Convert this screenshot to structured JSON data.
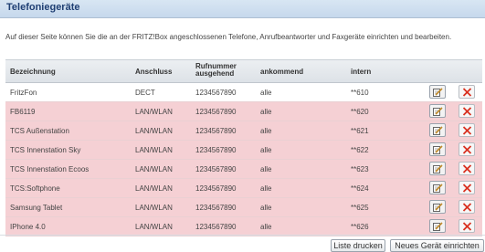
{
  "header": {
    "title": "Telefoniegeräte"
  },
  "intro": "Auf dieser Seite können Sie die an der FRITZ!Box angeschlossenen Telefone, Anrufbeantworter und Faxgeräte einrichten und bearbeiten.",
  "table": {
    "headers": {
      "name": "Bezeichnung",
      "anschluss": "Anschluss",
      "rufnummer_line1": "Rufnummer",
      "rufnummer_line2": "ausgehend",
      "ankommend": "ankommend",
      "intern": "intern"
    },
    "rows": [
      {
        "name": "FritzFon",
        "anschluss": "DECT",
        "rufnummer": "1234567890",
        "ankommend": "alle",
        "intern": "**610"
      },
      {
        "name": "FB6119",
        "anschluss": "LAN/WLAN",
        "rufnummer": "1234567890",
        "ankommend": "alle",
        "intern": "**620"
      },
      {
        "name": "TCS Außenstation",
        "anschluss": "LAN/WLAN",
        "rufnummer": "1234567890",
        "ankommend": "alle",
        "intern": "**621"
      },
      {
        "name": "TCS Innenstation Sky",
        "anschluss": "LAN/WLAN",
        "rufnummer": "1234567890",
        "ankommend": "alle",
        "intern": "**622"
      },
      {
        "name": "TCS Innenstation Ecoos",
        "anschluss": "LAN/WLAN",
        "rufnummer": "1234567890",
        "ankommend": "alle",
        "intern": "**623"
      },
      {
        "name": "TCS:Softphone",
        "anschluss": "LAN/WLAN",
        "rufnummer": "1234567890",
        "ankommend": "alle",
        "intern": "**624"
      },
      {
        "name": "Samsung Tablet",
        "anschluss": "LAN/WLAN",
        "rufnummer": "1234567890",
        "ankommend": "alle",
        "intern": "**625"
      },
      {
        "name": "IPhone 4.0",
        "anschluss": "LAN/WLAN",
        "rufnummer": "1234567890",
        "ankommend": "alle",
        "intern": "**626"
      }
    ],
    "row_icons": {
      "edit": "edit-icon",
      "delete": "delete-icon"
    }
  },
  "buttons": {
    "print_list": "Liste drucken",
    "add_device": "Neues Gerät einrichten"
  },
  "colors": {
    "title_text": "#1f3f73",
    "row_highlight": "#f5d0d4",
    "delete_red": "#d9301f"
  }
}
